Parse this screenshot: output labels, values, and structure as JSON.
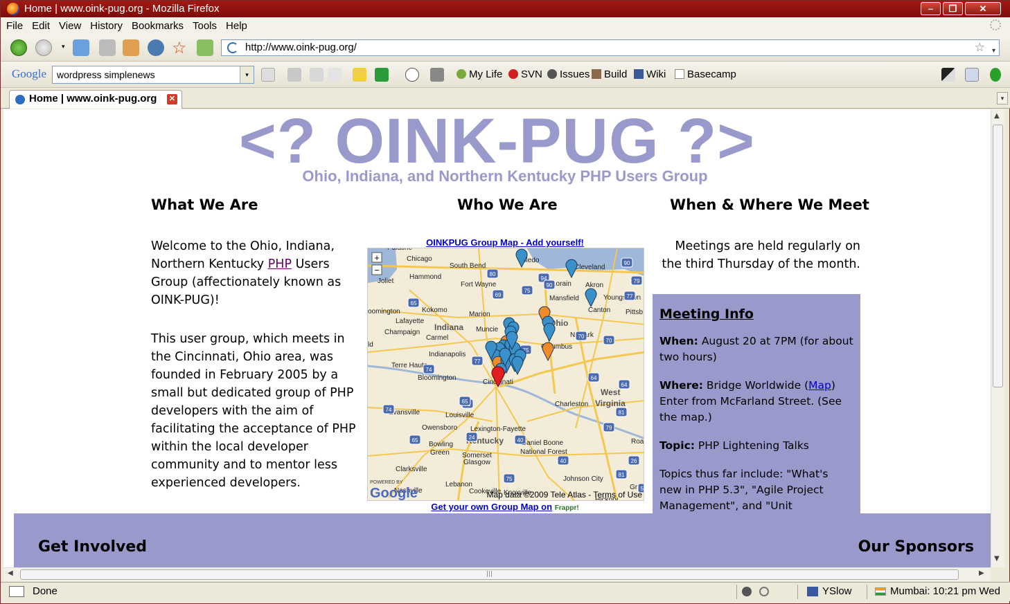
{
  "window": {
    "title": "Home | www.oink-pug.org - Mozilla Firefox"
  },
  "menu": [
    "File",
    "Edit",
    "View",
    "History",
    "Bookmarks",
    "Tools",
    "Help"
  ],
  "nav": {
    "url": "http://www.oink-pug.org/"
  },
  "google_toolbar": {
    "logo": "Google",
    "search_value": "wordpress simplenews",
    "bookmarks": [
      "My Life",
      "SVN",
      "Issues",
      "Build",
      "Wiki",
      "Basecamp"
    ]
  },
  "tab": {
    "label": "Home | www.oink-pug.org"
  },
  "page": {
    "title": "<? OINK-PUG ?>",
    "subtitle": "Ohio, Indiana, and Northern Kentucky PHP Users Group",
    "what": {
      "heading": "What We Are",
      "p1_pre": "Welcome to the Ohio, Indiana, Northern Kentucky ",
      "p1_link": "PHP",
      "p1_post": " Users Group (affectionately known as OINK-PUG)!",
      "p2": "This user group, which meets in the Cincinnati, Ohio area, was founded in February 2005 by a small but dedicated group of PHP developers with the aim of facilitating the acceptance of PHP within the local developer community and to mentor less experienced developers."
    },
    "who": {
      "heading": "Who We Are",
      "map_title": "OINKPUG Group Map",
      "map_sep": " - ",
      "map_add": "Add yourself!",
      "map_credit": "Map data ©2009 Tele Atlas - Terms of Use",
      "map_powered": "POWERED BY",
      "map_logo": "Google",
      "map_bottom": "Get your own Group Map on",
      "map_bottom_brand": "Frappr!",
      "places": [
        "Chicago",
        "Toledo",
        "Cleveland",
        "South Bend",
        "Hammond",
        "Fort Wayne",
        "Lorain",
        "Akron",
        "Joliet",
        "Youngstown",
        "Mansfield",
        "Canton",
        "Pittsb",
        "Kokomo",
        "Marion",
        "Lafayette",
        "Indiana",
        "Muncie",
        "Ohio",
        "Champaign",
        "Carmel",
        "Newark",
        "Columbus",
        "Indianapolis",
        "Terre Haute",
        "Bloomington",
        "Cincinnati",
        "West",
        "Virginia",
        "Charleston",
        "Evansville",
        "Louisville",
        "Owensboro",
        "Lexington-Fayette",
        "Bowling",
        "Green",
        "Kentucky",
        "Daniel Boone",
        "National Forest",
        "Somerset",
        "Glasgow",
        "Clarksville",
        "Nashville",
        "Lebanon",
        "Cookeville",
        "Knoxville",
        "Johnson City",
        "Roar",
        "Gree",
        "Hickory",
        "oomington",
        "ld",
        "Palatine"
      ],
      "highways": [
        "90",
        "80",
        "94",
        "90",
        "69",
        "75",
        "77",
        "79",
        "65",
        "70",
        "70",
        "74",
        "74",
        "71",
        "77",
        "64",
        "64",
        "75",
        "65",
        "81",
        "79",
        "24",
        "40",
        "26",
        "81",
        "75",
        "65",
        "40",
        "57"
      ]
    },
    "when": {
      "heading": "When & Where We Meet",
      "intro": "Meetings are held regularly on the third Thursday of the month.",
      "box_heading": "Meeting Info",
      "when_label": "When:",
      "when_value": " August 20 at 7PM (for about two hours)",
      "where_label": "Where:",
      "where_value": " Bridge Worldwide (",
      "where_link": "Map",
      "where_post": ") Enter from McFarland Street. (See the map.)",
      "topic_label": "Topic:",
      "topic_value": " PHP Lightening Talks",
      "topics": "Topics thus far include: \"What's new in PHP 5.3\", \"Agile Project Management\", and \"Unit"
    },
    "band": {
      "left": "Get Involved",
      "right": "Our Sponsors"
    }
  },
  "status": {
    "text": "Done",
    "yslow": "YSlow",
    "clock": "Mumbai: 10:21 pm Wed"
  },
  "colors": {
    "brand": "#9999cc",
    "link": "#0000cc",
    "visited": "#660066"
  }
}
